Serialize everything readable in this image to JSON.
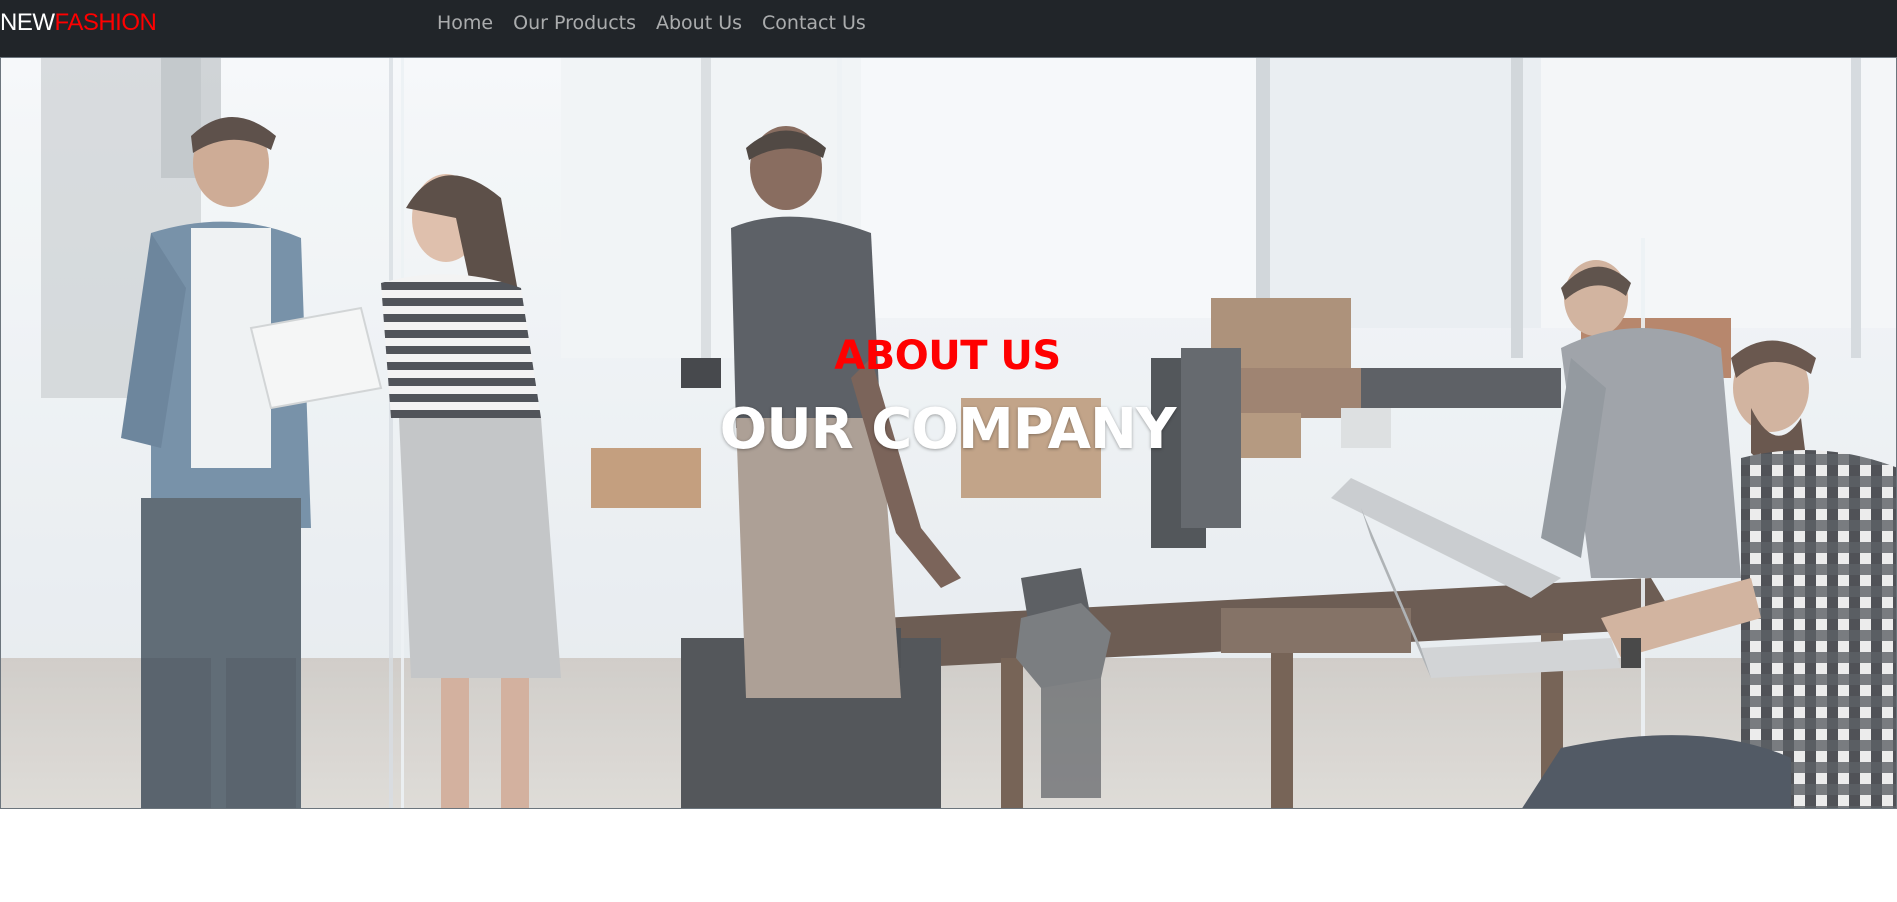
{
  "brand": {
    "part1": "NEW",
    "part2": "FASHION"
  },
  "nav": [
    {
      "label": "Home"
    },
    {
      "label": "Our Products"
    },
    {
      "label": "About Us"
    },
    {
      "label": "Contact Us"
    }
  ],
  "hero": {
    "kicker": "ABOUT US",
    "title": "OUR COMPANY"
  },
  "colors": {
    "navbar_bg": "#212529",
    "accent_red": "#ff0000",
    "nav_text": "#a6a8aa"
  }
}
